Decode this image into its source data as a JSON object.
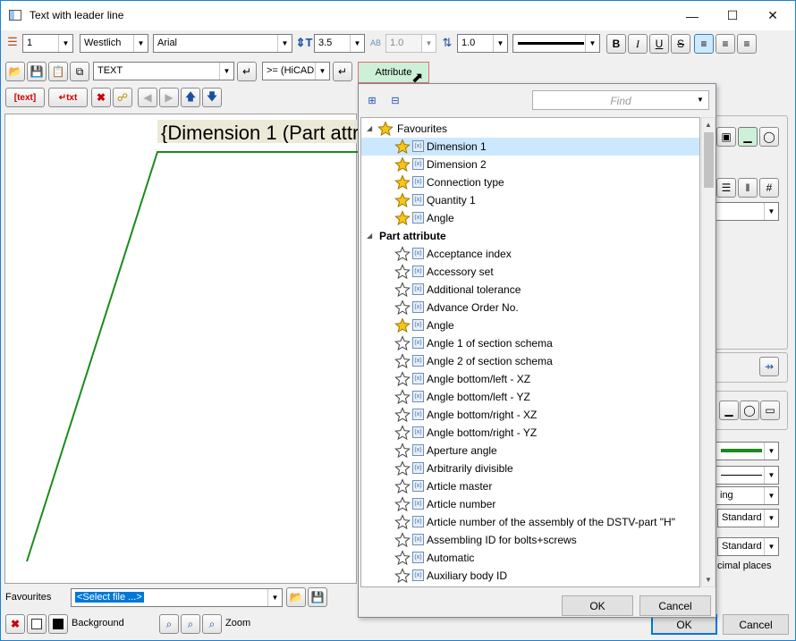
{
  "window": {
    "title": "Text with leader line"
  },
  "toolbar1": {
    "layer": "1",
    "font_style": "Westlich",
    "font_name": "Arial",
    "text_height": "3.5",
    "width_factor": "1.0",
    "line_spacing": "1.0"
  },
  "toolbar2": {
    "text_field": "TEXT",
    "operator": ">= (HiCAD",
    "attribute_button": "Attribute"
  },
  "canvas": {
    "text": "{Dimension 1 (Part attri"
  },
  "popup": {
    "find_placeholder": "Find",
    "ok": "OK",
    "cancel": "Cancel",
    "groups": [
      {
        "label": "Favourites",
        "items": [
          {
            "label": "Dimension 1",
            "fav": true
          },
          {
            "label": "Dimension 2",
            "fav": true
          },
          {
            "label": "Connection type",
            "fav": true
          },
          {
            "label": "Quantity 1",
            "fav": true
          },
          {
            "label": "Angle",
            "fav": true
          }
        ]
      },
      {
        "label": "Part attribute",
        "items": [
          {
            "label": "Acceptance index",
            "fav": false
          },
          {
            "label": "Accessory set",
            "fav": false
          },
          {
            "label": "Additional tolerance",
            "fav": false
          },
          {
            "label": "Advance Order No.",
            "fav": false
          },
          {
            "label": "Angle",
            "fav": true
          },
          {
            "label": "Angle 1 of section schema",
            "fav": false
          },
          {
            "label": "Angle 2 of section schema",
            "fav": false
          },
          {
            "label": "Angle bottom/left - XZ",
            "fav": false
          },
          {
            "label": "Angle bottom/left - YZ",
            "fav": false
          },
          {
            "label": "Angle bottom/right - XZ",
            "fav": false
          },
          {
            "label": "Angle bottom/right - YZ",
            "fav": false
          },
          {
            "label": "Aperture angle",
            "fav": false
          },
          {
            "label": "Arbitrarily divisible",
            "fav": false
          },
          {
            "label": "Article master",
            "fav": false
          },
          {
            "label": "Article number",
            "fav": false
          },
          {
            "label": "Article number of the assembly of the DSTV-part \"H\"",
            "fav": false
          },
          {
            "label": "Assembling ID for bolts+screws",
            "fav": false
          },
          {
            "label": "Automatic",
            "fav": false
          },
          {
            "label": "Auxiliary body ID",
            "fav": false
          }
        ]
      }
    ]
  },
  "right_panel": {
    "fragment_ing": "ing",
    "standard1": "Standard",
    "standard2": "Standard",
    "decimal_places": "cimal places"
  },
  "bottom": {
    "favourites_label": "Favourites",
    "select_file": "<Select file ...>",
    "background_label": "Background",
    "zoom_label": "Zoom",
    "ok": "OK",
    "cancel": "Cancel"
  },
  "colors": {
    "leader_line": "#1a8c1a",
    "selection": "#cce8ff",
    "star_fill": "#f5c518",
    "accent": "#0078d7"
  }
}
